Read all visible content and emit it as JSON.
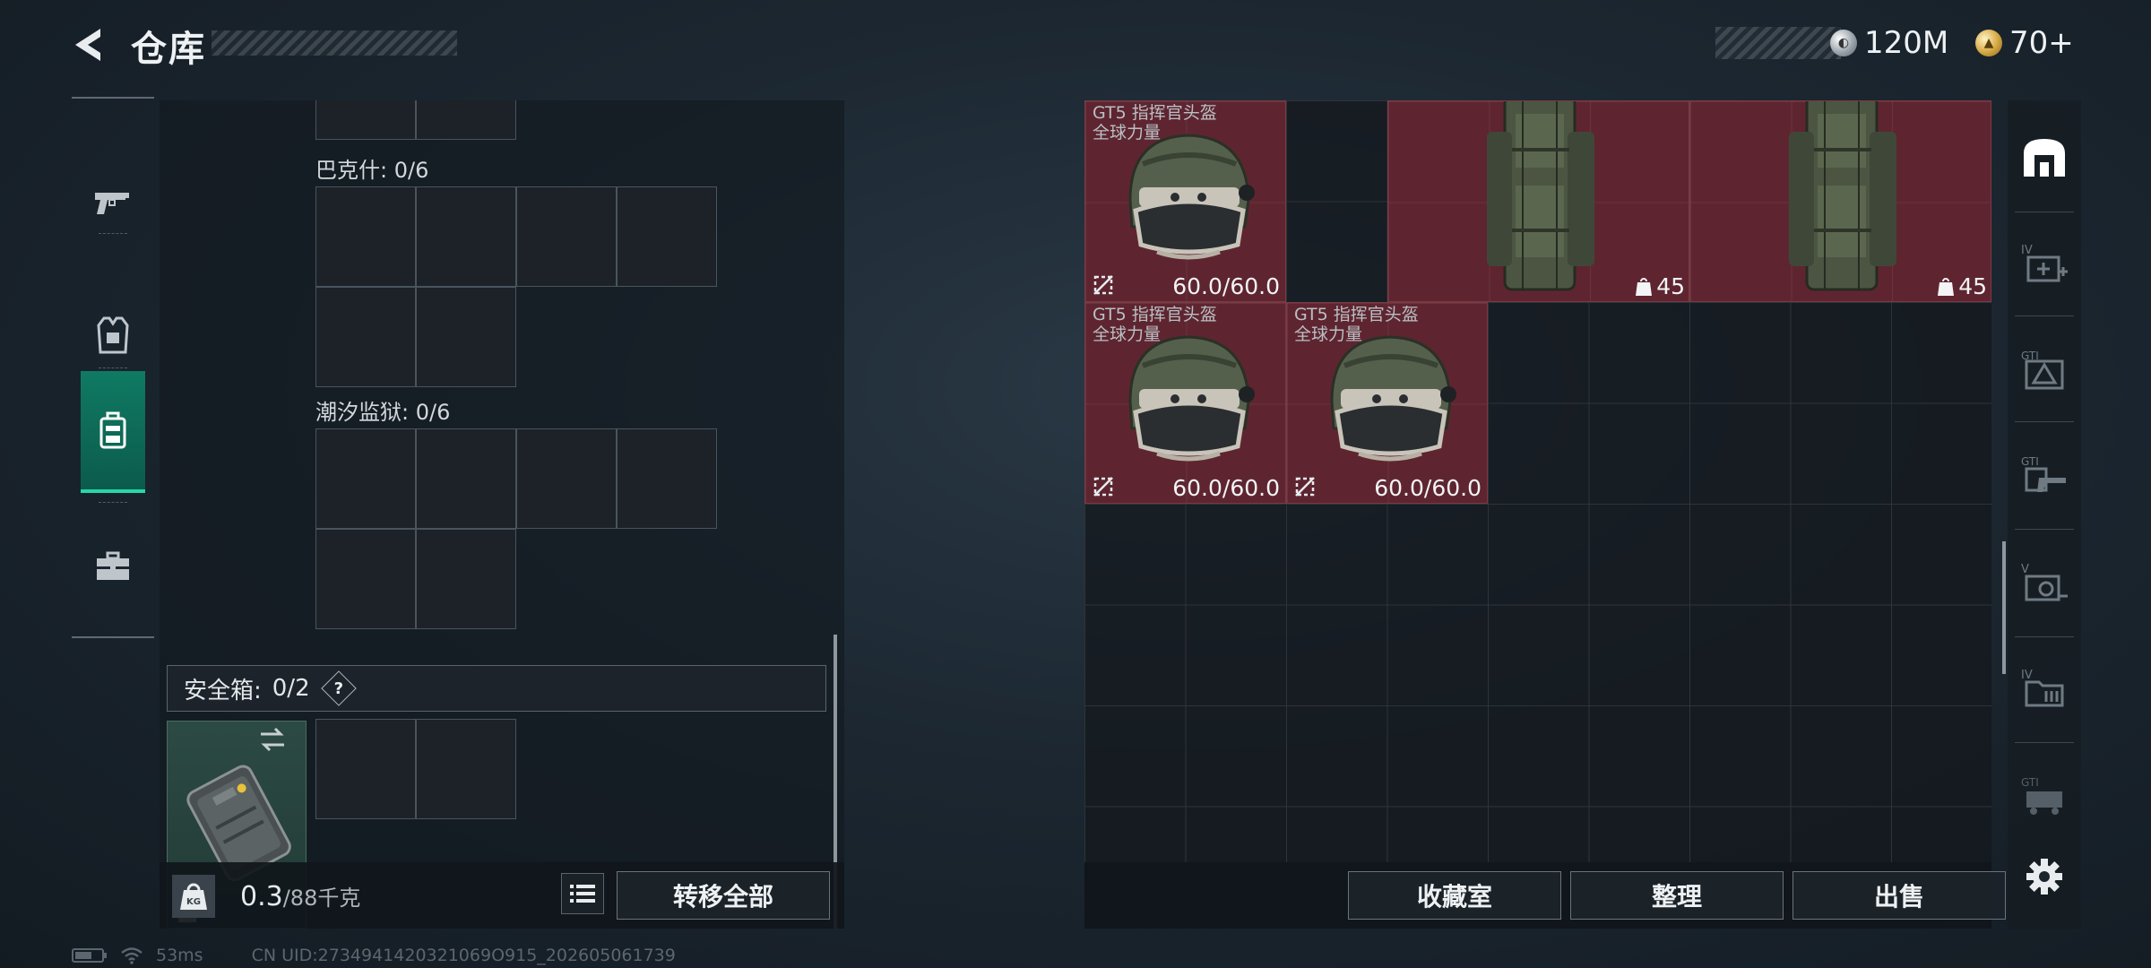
{
  "header": {
    "title": "仓库",
    "currencies": [
      {
        "icon": "silver-coin-icon",
        "value": "120M"
      },
      {
        "icon": "gold-coin-icon",
        "value": "70+"
      }
    ]
  },
  "left_rail": {
    "tabs": [
      {
        "name": "weapon",
        "icon": "pistol-icon",
        "active": false
      },
      {
        "name": "armor",
        "icon": "vest-icon",
        "active": false
      },
      {
        "name": "container",
        "icon": "backpack-icon",
        "active": true
      },
      {
        "name": "kit",
        "icon": "toolbox-icon",
        "active": false
      }
    ]
  },
  "storage": {
    "sections": [
      {
        "label": "巴克什: 0/6"
      },
      {
        "label": "潮汐监狱: 0/6"
      }
    ],
    "safe_box": {
      "label": "安全箱:",
      "count": "0/2",
      "help": "?"
    },
    "weight": {
      "current": "0.3",
      "max": "/88千克",
      "icon_text": "KG"
    },
    "transfer_all": "转移全部"
  },
  "inventory": {
    "items": [
      {
        "name": "GT5 指挥官头盔",
        "subtitle": "全球力量",
        "durability": "60.0/60.0",
        "type": "helmet"
      },
      {
        "count": "45",
        "type": "backpack"
      },
      {
        "count": "45",
        "type": "backpack"
      },
      {
        "name": "GT5 指挥官头盔",
        "subtitle": "全球力量",
        "durability": "60.0/60.0",
        "type": "helmet"
      },
      {
        "name": "GT5 指挥官头盔",
        "subtitle": "全球力量",
        "durability": "60.0/60.0",
        "type": "helmet"
      }
    ],
    "buttons": {
      "collection": "收藏室",
      "organize": "整理",
      "sell": "出售"
    }
  },
  "right_rail": {
    "tabs": [
      {
        "label": "",
        "icon": "warehouse-icon"
      },
      {
        "label": "IV",
        "icon": "medkit-icon"
      },
      {
        "label": "GTI",
        "icon": "warning-pack-icon"
      },
      {
        "label": "GTI",
        "icon": "rifle-tab-icon"
      },
      {
        "label": "V",
        "icon": "gear-case-icon"
      },
      {
        "label": "IV",
        "icon": "folder-icon"
      },
      {
        "label": "GTI",
        "icon": "vehicle-icon"
      }
    ]
  },
  "status": {
    "ping": "53ms",
    "uid": "CN UID:2734941420321069O915_202605061739"
  },
  "colors": {
    "accent": "#27d7a7",
    "item_red": "#5e2530"
  }
}
